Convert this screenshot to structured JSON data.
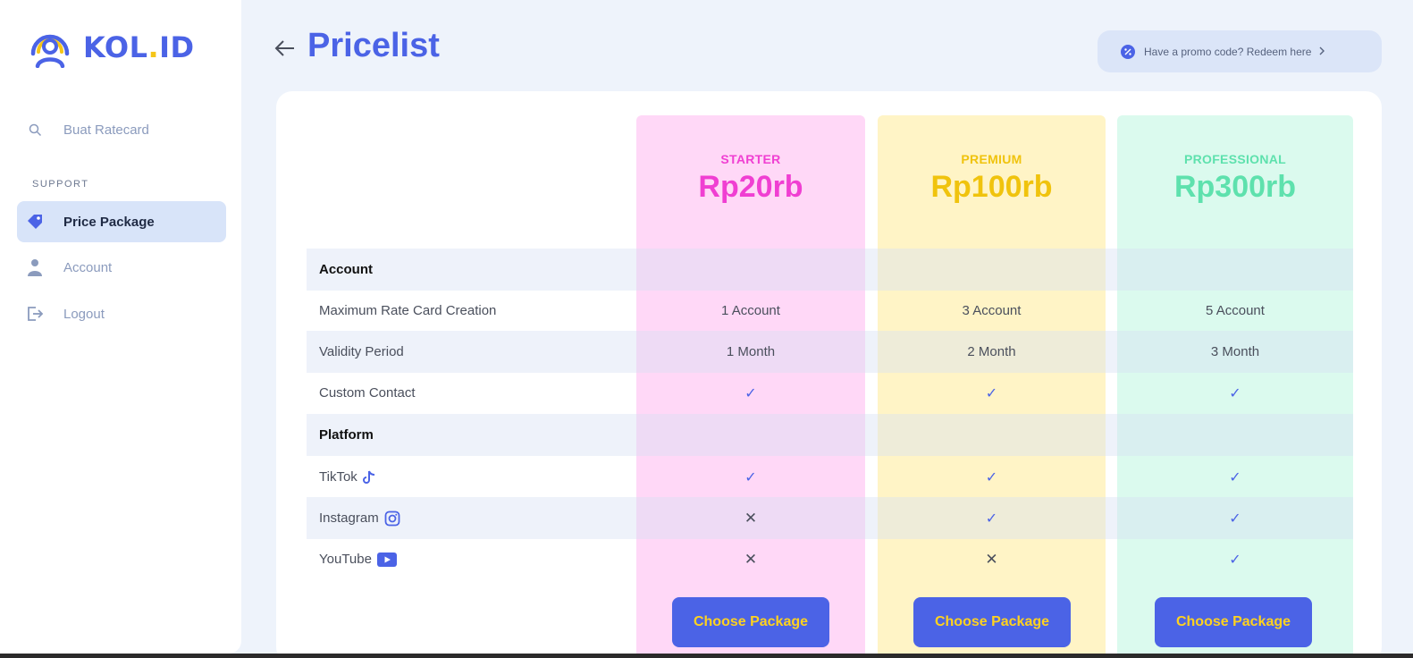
{
  "brand": {
    "name_part1": "KOL",
    "name_dot": ".",
    "name_part2": "ID",
    "primary_color": "#4b63e6",
    "accent_color": "#f5c518"
  },
  "sidebar": {
    "search_label": "Buat Ratecard",
    "section_label": "SUPPORT",
    "items": [
      {
        "label": "Price Package",
        "icon": "price-tag-icon",
        "active": true
      },
      {
        "label": "Account",
        "icon": "user-icon",
        "active": false
      },
      {
        "label": "Logout",
        "icon": "logout-icon",
        "active": false
      }
    ]
  },
  "header": {
    "title": "Pricelist",
    "promo_text": "Have a promo code? Redeem here"
  },
  "plans": [
    {
      "tier": "STARTER",
      "price": "Rp20rb",
      "color": "#f03fd2",
      "bg": "#ffd8f7",
      "button": "Choose Package"
    },
    {
      "tier": "PREMIUM",
      "price": "Rp100rb",
      "color": "#f0c30d",
      "bg": "#fff4c6",
      "button": "Choose Package"
    },
    {
      "tier": "PROFESSIONAL",
      "price": "Rp300rb",
      "color": "#5ee1ad",
      "bg": "#dbfaee",
      "button": "Choose Package"
    }
  ],
  "table": {
    "sections": {
      "account": "Account",
      "platform": "Platform"
    },
    "rows": {
      "max_rate_card": {
        "label": "Maximum Rate Card Creation",
        "values": [
          "1 Account",
          "3 Account",
          "5 Account"
        ]
      },
      "validity": {
        "label": "Validity Period",
        "values": [
          "1 Month",
          "2 Month",
          "3 Month"
        ]
      },
      "custom_contact": {
        "label": "Custom Contact",
        "values": [
          "check",
          "check",
          "check"
        ]
      },
      "tiktok": {
        "label": "TikTok",
        "values": [
          "check",
          "check",
          "check"
        ]
      },
      "instagram": {
        "label": "Instagram",
        "values": [
          "cross",
          "check",
          "check"
        ]
      },
      "youtube": {
        "label": "YouTube",
        "values": [
          "cross",
          "cross",
          "check"
        ]
      }
    },
    "symbols": {
      "check": "✓",
      "cross": "✕"
    }
  }
}
